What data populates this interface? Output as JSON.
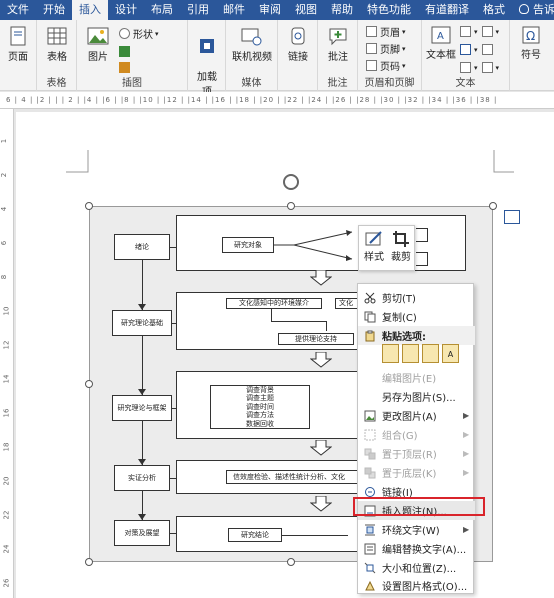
{
  "ribbon_tabs": [
    "文件",
    "开始",
    "插入",
    "设计",
    "布局",
    "引用",
    "邮件",
    "审阅",
    "视图",
    "帮助",
    "特色功能",
    "有道翻译",
    "格式",
    "告诉我"
  ],
  "active_tab": "插入",
  "ribbon": {
    "page": "页面",
    "table": "表格",
    "table_group": "表格",
    "picture": "图片",
    "shape": "形状",
    "illustration_group": "插图",
    "addins": "加载\n项",
    "online_video": "联机视频",
    "media_group": "媒体",
    "link": "链接",
    "comment": "批注",
    "comment_group": "批注",
    "header": "页眉",
    "footer": "页脚",
    "page_number": "页码",
    "header_footer_group": "页眉和页脚",
    "textbox": "文本框",
    "text_group": "文本",
    "symbol": "符号"
  },
  "ruler_text": "6  |  4 |  |2 |  |  |  2 |  |4 |  |6 |  |8 |  |10 |  |12 |  |14 |  |16 |  |18 |  |20 |  |22 |  |24 |  |26 |  |28 |  |30 |  |32 |  |34 |  |36 |  |38 |",
  "vruler_marks": [
    "1",
    "2",
    "4",
    "6",
    "8",
    "10",
    "12",
    "14",
    "16",
    "18",
    "20",
    "22",
    "24",
    "26"
  ],
  "flowchart": {
    "left": [
      "绪论",
      "研究理论基础",
      "研究理论与框架",
      "实证分析",
      "对策及展望"
    ],
    "research_object": "研究对象",
    "env_text": "文化感知中的环境媒介",
    "env_text2": "文化",
    "theory_support": "提供理论支持",
    "survey": "调查背景\n调查主题\n调查时间\n调查方法\n数据回收",
    "analysis": "信效度检验、描述性统计分析、文化",
    "conclusion": "研究结论"
  },
  "minibar": {
    "style": "样式",
    "crop": "裁剪"
  },
  "context_menu": [
    {
      "label": "剪切(T)",
      "icon": "scissors-icon",
      "enabled": true,
      "submenu": false
    },
    {
      "label": "复制(C)",
      "icon": "copy-icon",
      "enabled": true,
      "submenu": false
    },
    {
      "label": "粘贴选项:",
      "icon": "paste-icon",
      "enabled": true,
      "submenu": false
    },
    {
      "label": "编辑图片(E)",
      "icon": "",
      "enabled": false,
      "submenu": false
    },
    {
      "label": "另存为图片(S)...",
      "icon": "",
      "enabled": true,
      "submenu": false
    },
    {
      "label": "更改图片(A)",
      "icon": "change-picture-icon",
      "enabled": true,
      "submenu": true
    },
    {
      "label": "组合(G)",
      "icon": "group-icon",
      "enabled": false,
      "submenu": true
    },
    {
      "label": "置于顶层(R)",
      "icon": "bring-front-icon",
      "enabled": false,
      "submenu": true
    },
    {
      "label": "置于底层(K)",
      "icon": "send-back-icon",
      "enabled": false,
      "submenu": true
    },
    {
      "label": "链接(I)",
      "icon": "link-icon",
      "enabled": true,
      "submenu": false
    },
    {
      "label": "插入题注(N)...",
      "icon": "caption-icon",
      "enabled": true,
      "submenu": false
    },
    {
      "label": "环绕文字(W)",
      "icon": "wrap-text-icon",
      "enabled": true,
      "submenu": true
    },
    {
      "label": "编辑替换文字(A)...",
      "icon": "alt-text-icon",
      "enabled": true,
      "submenu": false
    },
    {
      "label": "大小和位置(Z)...",
      "icon": "size-position-icon",
      "enabled": true,
      "submenu": false
    },
    {
      "label": "设置图片格式(O)...",
      "icon": "format-picture-icon",
      "enabled": true,
      "submenu": false
    }
  ],
  "colors": {
    "ribbon_blue": "#2b579a",
    "highlight_red": "#d9242b"
  }
}
